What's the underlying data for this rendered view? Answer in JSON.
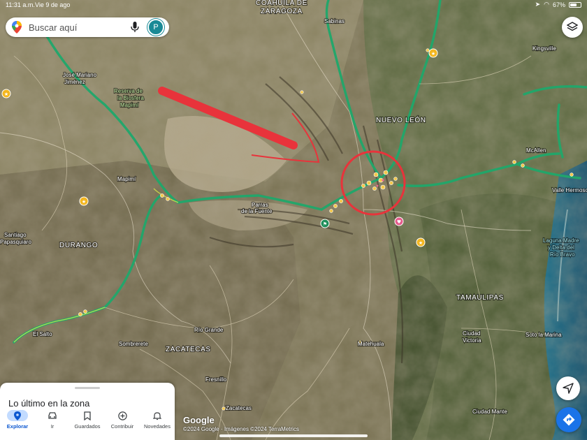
{
  "status_bar": {
    "time": "11:31 a.m.",
    "date": "Vie 9 de ago",
    "battery": "67%",
    "battery_level": 0.67
  },
  "search": {
    "placeholder": "Buscar aquí",
    "avatar_letter": "P"
  },
  "icons": {
    "maps_pin": "maps-pin-icon",
    "mic": "mic-icon",
    "layers": "layers-icon",
    "compass": "navigation-arrow-icon",
    "directions": "directions-icon"
  },
  "map": {
    "labels": {
      "coahuila": "COAHUILA DE",
      "zaragoza": "ZARAGOZA",
      "sabinas": "Sabinas",
      "kingsville": "Kingsville",
      "jose_mariano": "José Mariano",
      "jimenez": "Jiménez",
      "reserva1": "Reserva de",
      "reserva2": "la Biosfera",
      "reserva3": "Mapimí",
      "nuevo_leon": "NUEVO LEÓN",
      "mcallen": "McAllen",
      "mapimi": "Mapimí",
      "valle_hermoso": "Valle Hermoso",
      "parras1": "Parras",
      "parras2": "de la Fuente",
      "santiago1": "Santiago",
      "santiago2": "Papasquiaro",
      "durango": "DURANGO",
      "laguna1": "Laguna Madre",
      "laguna2": "y Delta del",
      "laguna3": "Río Bravo",
      "tamaulipas": "TAMAULIPAS",
      "el_salto": "El Salto",
      "rio_grande": "Río Grande",
      "sombrerete": "Sombrerete",
      "matehuala": "Matehuala",
      "ciudad_victoria1": "Ciudad",
      "ciudad_victoria2": "Victoria",
      "soto_la_marina": "Soto la Marina",
      "zacatecas_state": "ZACATECAS",
      "fresnillo": "Fresnillo",
      "zacatecas_city": "Zacatecas",
      "ciudad_mante": "Ciudad Mante"
    }
  },
  "sheet": {
    "title": "Lo último en la zona"
  },
  "nav": [
    {
      "label": "Explorar",
      "icon": "explore-pin-icon"
    },
    {
      "label": "Ir",
      "icon": "car-icon"
    },
    {
      "label": "Guardados",
      "icon": "bookmark-icon"
    },
    {
      "label": "Contribuir",
      "icon": "add-circle-icon"
    },
    {
      "label": "Novedades",
      "icon": "bell-icon"
    }
  ],
  "attribution": {
    "logo": "Google",
    "text": "©2024 Google · Imágenes ©2024 TerraMetrics"
  },
  "colors": {
    "annotation_red": "#e8333b",
    "highway_green": "#1fa86b",
    "accent_blue": "#1a73e8"
  }
}
